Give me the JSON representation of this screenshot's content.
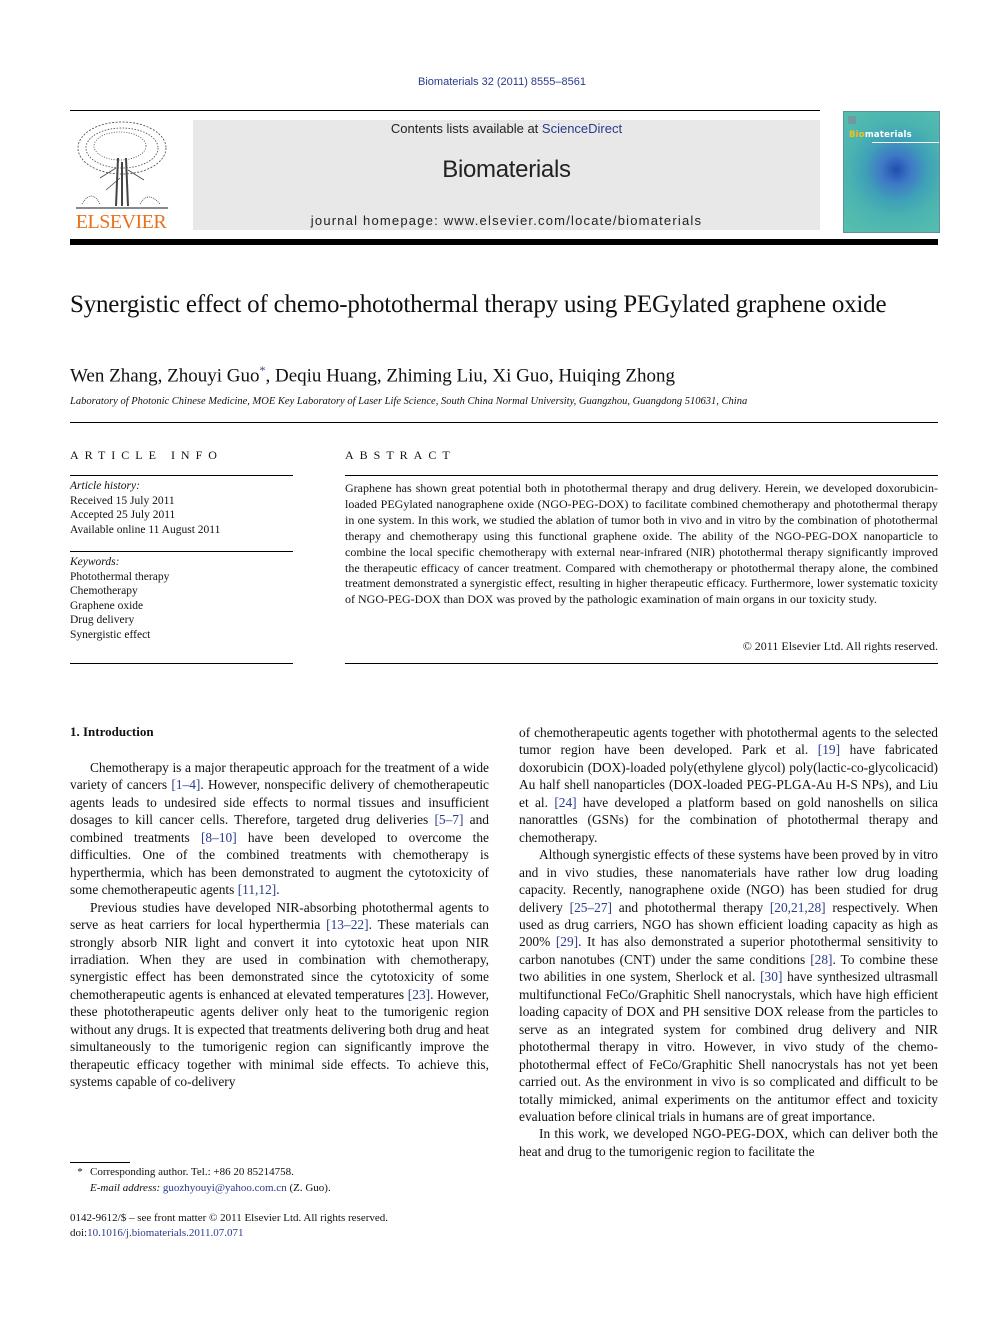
{
  "journal_ref": "Biomaterials 32 (2011) 8555–8561",
  "masthead": {
    "contents_prefix": "Contents lists available at ",
    "contents_link": "ScienceDirect",
    "journal_name": "Biomaterials",
    "homepage": "journal homepage: www.elsevier.com/locate/biomaterials",
    "publisher_logo_text": "ELSEVIER",
    "cover_title_prefix": "Bio",
    "cover_title_suffix": "materials"
  },
  "colors": {
    "link": "#2a3a8c",
    "elsevier_orange": "#e9711c",
    "masthead_bg": "#e8e8e8"
  },
  "article": {
    "title": "Synergistic effect of chemo-photothermal therapy using PEGylated graphene oxide",
    "authors_before_star": "Wen Zhang, Zhouyi Guo",
    "corresponding_mark": "*",
    "authors_after_star": ", Deqiu Huang, Zhiming Liu, Xi Guo, Huiqing Zhong",
    "affiliation": "Laboratory of Photonic Chinese Medicine, MOE Key Laboratory of Laser Life Science, South China Normal University, Guangzhou, Guangdong 510631, China"
  },
  "article_info": {
    "heading": "ARTICLE INFO",
    "history_label": "Article history:",
    "history": [
      "Received 15 July 2011",
      "Accepted 25 July 2011",
      "Available online 11 August 2011"
    ],
    "keywords_label": "Keywords:",
    "keywords": [
      "Photothermal therapy",
      "Chemotherapy",
      "Graphene oxide",
      "Drug delivery",
      "Synergistic effect"
    ]
  },
  "abstract": {
    "heading": "ABSTRACT",
    "text": "Graphene has shown great potential both in photothermal therapy and drug delivery. Herein, we developed doxorubicin-loaded PEGylated nanographene oxide (NGO-PEG-DOX) to facilitate combined chemotherapy and photothermal therapy in one system. In this work, we studied the ablation of tumor both in vivo and in vitro by the combination of photothermal therapy and chemotherapy using this functional graphene oxide. The ability of the NGO-PEG-DOX nanoparticle to combine the local specific chemotherapy with external near-infrared (NIR) photothermal therapy significantly improved the therapeutic efficacy of cancer treatment. Compared with chemotherapy or photothermal therapy alone, the combined treatment demonstrated a synergistic effect, resulting in higher therapeutic efficacy. Furthermore, lower systematic toxicity of NGO-PEG-DOX than DOX was proved by the pathologic examination of main organs in our toxicity study.",
    "copyright": "© 2011 Elsevier Ltd. All rights reserved."
  },
  "intro": {
    "heading": "1.  Introduction",
    "p1": [
      "Chemotherapy is a major therapeutic approach for the treatment of a wide variety of cancers ",
      "[1–4]",
      ". However, nonspecific delivery of chemotherapeutic agents leads to undesired side effects to normal tissues and insufficient dosages to kill cancer cells. Therefore, targeted drug deliveries ",
      "[5–7]",
      " and combined treatments ",
      "[8–10]",
      " have been developed to overcome the difficulties. One of the combined treatments with chemotherapy is hyperthermia, which has been demonstrated to augment the cytotoxicity of some chemotherapeutic agents ",
      "[11,12]",
      "."
    ],
    "p2": [
      "Previous studies have developed NIR-absorbing photothermal agents to serve as heat carriers for local hyperthermia ",
      "[13–22]",
      ". These materials can strongly absorb NIR light and convert it into cytotoxic heat upon NIR irradiation. When they are used in combination with chemotherapy, synergistic effect has been demonstrated since the cytotoxicity of some chemotherapeutic agents is enhanced at elevated temperatures ",
      "[23]",
      ". However, these phototherapeutic agents deliver only heat to the tumorigenic region without any drugs. It is expected that treatments delivering both drug and heat simultaneously to the tumorigenic region can significantly improve the therapeutic efficacy together with minimal side effects. To achieve this, systems capable of co-delivery"
    ],
    "p2_cont": [
      "of chemotherapeutic agents together with photothermal agents to the selected tumor region have been developed. Park et al. ",
      "[19]",
      " have fabricated doxorubicin (DOX)-loaded poly(ethylene glycol) poly(lactic-co-glycolicacid) Au half shell nanoparticles (DOX-loaded PEG-PLGA-Au H-S NPs), and Liu et al. ",
      "[24]",
      " have developed a platform based on gold nanoshells on silica nanorattles (GSNs) for the combination of photothermal therapy and chemotherapy."
    ],
    "p3": [
      "Although synergistic effects of these systems have been proved by in vitro and in vivo studies, these nanomaterials have rather low drug loading capacity. Recently, nanographene oxide (NGO) has been studied for drug delivery ",
      "[25–27]",
      " and photothermal therapy ",
      "[20,21,28]",
      " respectively. When used as drug carriers, NGO has shown efficient loading capacity as high as 200% ",
      "[29]",
      ". It has also demonstrated a superior photothermal sensitivity to carbon nanotubes (CNT) under the same conditions ",
      "[28]",
      ". To combine these two abilities in one system, Sherlock et al. ",
      "[30]",
      " have synthesized ultrasmall multifunctional FeCo/Graphitic Shell nanocrystals, which have high efficient loading capacity of DOX and PH sensitive DOX release from the particles to serve as an integrated system for combined drug delivery and NIR photothermal therapy in vitro. However, in vivo study of the chemo-photothermal effect of FeCo/Graphitic Shell nanocrystals has not yet been carried out. As the environment in vivo is so complicated and difficult to be totally mimicked, animal experiments on the antitumor effect and toxicity evaluation before clinical trials in humans are of great importance."
    ],
    "p4": [
      "In this work, we developed NGO-PEG-DOX, which can deliver both the heat and drug to the tumorigenic region to facilitate the"
    ]
  },
  "footnote": {
    "star": "*",
    "corresponding": "Corresponding author. Tel.: +86 20 85214758.",
    "email_label": "E-mail address: ",
    "email": "guozhyouyi@yahoo.com.cn",
    "email_suffix": " (Z. Guo)."
  },
  "front_matter": {
    "issn_line": "0142-9612/$ – see front matter © 2011 Elsevier Ltd. All rights reserved.",
    "doi_prefix": "doi:",
    "doi": "10.1016/j.biomaterials.2011.07.071"
  }
}
